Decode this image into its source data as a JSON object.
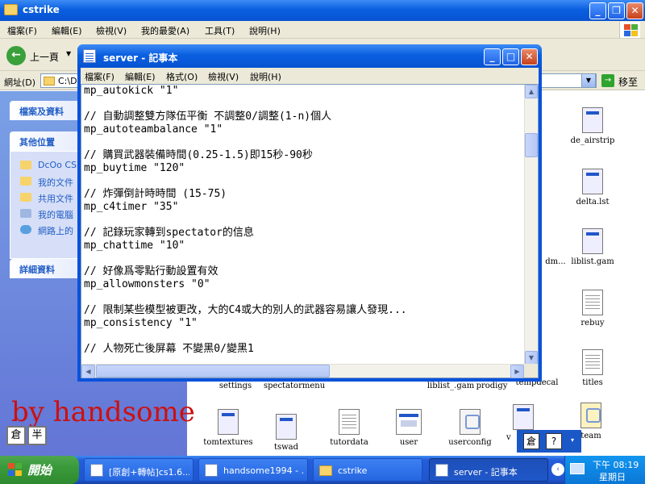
{
  "explorer": {
    "title": "cstrike",
    "menu": [
      "檔案(F)",
      "編輯(E)",
      "檢視(V)",
      "我的最愛(A)",
      "工具(T)",
      "說明(H)"
    ],
    "toolbar": {
      "back_label": "上一頁"
    },
    "address": {
      "label": "網址(D)",
      "value": "C:\\D",
      "go_label": "移至"
    },
    "taskpane": {
      "sections": [
        "檔案及資料",
        "其他位置",
        "詳細資料"
      ],
      "places": [
        "DcOo CS",
        "我的文件",
        "共用文件",
        "我的電腦",
        "網路上的"
      ]
    },
    "files": [
      {
        "label": "de_airstrip",
        "kind": "app"
      },
      {
        "label": "delta.lst",
        "kind": "app"
      },
      {
        "label": "liblist.gam",
        "kind": "app"
      },
      {
        "label": "dm...",
        "kind": "blank"
      },
      {
        "label": "rebuy",
        "kind": "doc"
      },
      {
        "label": "titles",
        "kind": "doc"
      },
      {
        "label": "settings",
        "kind": "blank"
      },
      {
        "label": "spectatormenu",
        "kind": "blank"
      },
      {
        "label": "liblist_.gam",
        "kind": "blank"
      },
      {
        "label": "prodigy",
        "kind": "blank"
      },
      {
        "label": "tempdecal",
        "kind": "blank"
      },
      {
        "label": "tomtextures",
        "kind": "app"
      },
      {
        "label": "tswad",
        "kind": "app"
      },
      {
        "label": "tutordata",
        "kind": "doc"
      },
      {
        "label": "user",
        "kind": "win"
      },
      {
        "label": "userconfig",
        "kind": "cfg"
      },
      {
        "label": "v",
        "kind": "app"
      },
      {
        "label": "team",
        "kind": "cfg"
      }
    ]
  },
  "notepad": {
    "title": "server - 記事本",
    "menu": [
      "檔案(F)",
      "編輯(E)",
      "格式(O)",
      "檢視(V)",
      "說明(H)"
    ],
    "lines": [
      "mp_autokick \"1\"",
      "",
      "// 自動調整雙方隊伍平衡 不調整0/調整(1-n)個人",
      "mp_autoteambalance \"1\"",
      "",
      "// 購買武器裝備時間(0.25-1.5)即15秒-90秒",
      "mp_buytime \"120\"",
      "",
      "// 炸彈倒計時時間 (15-75)",
      "mp_c4timer \"35\"",
      "",
      "// 記錄玩家轉到spectator的信息",
      "mp_chattime \"10\"",
      "",
      "// 好像爲零點行動設置有效",
      "mp_allowmonsters \"0\"",
      "",
      "// 限制某些模型被更改，大的C4或大的別人的武器容易讓人發現...",
      "mp_consistency \"1\"",
      "",
      "// 人物死亡後屏幕 不變黑0/變黑1"
    ]
  },
  "watermark": "by handsome",
  "ime_left": [
    "倉",
    "半"
  ],
  "ime_right": [
    "倉",
    "?"
  ],
  "taskbar": {
    "start_label": "開始",
    "buttons": [
      "[原創+轉帖]cs1.6...",
      "handsome1994 - ...",
      "cstrike",
      "server - 記事本"
    ],
    "clock": {
      "time": "下午 08:19",
      "day": "星期日"
    }
  },
  "colors": {
    "titlebar": "#0a5fe0",
    "taskbar": "#245edb",
    "start": "#3a9a3a",
    "watermark": "#cc1010",
    "taskpane": "#6f8ddf"
  }
}
